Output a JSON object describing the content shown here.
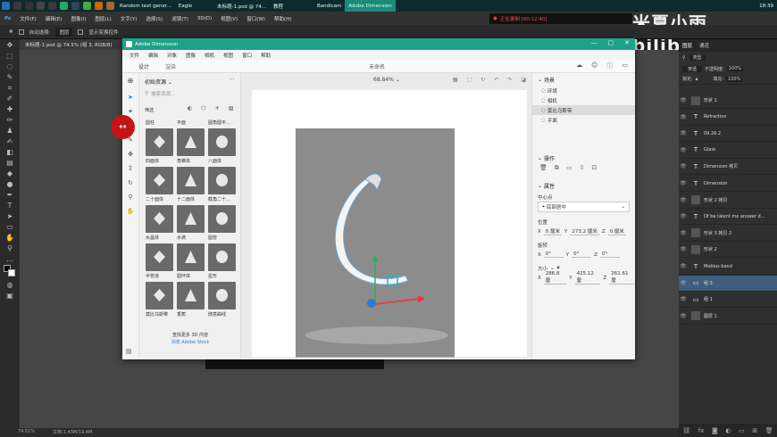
{
  "taskbar": {
    "tabs": [
      {
        "label": "Random text gener..."
      },
      {
        "label": "Eagle"
      },
      {
        "label": "未标题-1.psd @ 74..."
      },
      {
        "label": "教程"
      },
      {
        "label": "Bandicam"
      },
      {
        "label": "Adobe Dimension"
      }
    ],
    "clock": "18:39"
  },
  "recording": {
    "text": "正在录制 [00:12:40]"
  },
  "ps": {
    "menu": [
      "文件(F)",
      "编辑(E)",
      "图像(I)",
      "图层(L)",
      "文字(Y)",
      "选择(S)",
      "滤镜(T)",
      "3D(D)",
      "视图(V)",
      "窗口(W)",
      "帮助(H)"
    ],
    "options": {
      "auto_select": "自动选择:",
      "group": "图层",
      "transform": "显示变换控件"
    },
    "doc_tab": "未标题-1.psd @ 74.5% (组 3, RGB/8)",
    "status": {
      "zoom": "74.51%",
      "doc": "文档:1.43M/19.4M"
    }
  },
  "watermark": {
    "text": "米夏小雨 bilibili"
  },
  "layers_panel": {
    "tabs": [
      "图层",
      "通道"
    ],
    "kind_label": "类型",
    "blend": "穿透",
    "opacity_label": "不透明度:",
    "opacity": "100%",
    "lock_label": "锁定:",
    "fill_label": "填充:",
    "fill": "100%",
    "layers": [
      {
        "name": "形状 1",
        "type": "shape"
      },
      {
        "name": "Refraction",
        "type": "text"
      },
      {
        "name": "09.26.2",
        "type": "text"
      },
      {
        "name": "Glass",
        "type": "text"
      },
      {
        "name": "Dimension 拷贝",
        "type": "text"
      },
      {
        "name": "Dimension",
        "type": "text"
      },
      {
        "name": "形状 2 拷贝",
        "type": "shape"
      },
      {
        "name": "Of be talent me answer d...",
        "type": "text"
      },
      {
        "name": "形状 3 拷贝 2",
        "type": "shape"
      },
      {
        "name": "形状 2",
        "type": "shape"
      },
      {
        "name": "Mobius band",
        "type": "text"
      },
      {
        "name": "组 3",
        "type": "group",
        "selected": true
      },
      {
        "name": "组 1",
        "type": "group"
      },
      {
        "name": "图层 1",
        "type": "shape"
      }
    ]
  },
  "dimension": {
    "window_title": "Adobe Dimension",
    "menu": [
      "文件",
      "编辑",
      "对象",
      "图像",
      "相机",
      "视图",
      "窗口",
      "帮助"
    ],
    "modes": [
      "设计",
      "渲染"
    ],
    "doc_name": "未命名",
    "zoom": "68.84%",
    "library": {
      "title": "初始资源",
      "search_placeholder": "搜索资源...",
      "filter_label": "筛选",
      "row0": [
        "圆柱",
        "平面",
        "圆角圆平..."
      ],
      "items": [
        "四面体",
        "角锥体",
        "八面体",
        "二十面体",
        "十二面体",
        "截角二十...",
        "水晶体",
        "水滴",
        "圆管",
        "半管道",
        "圆环体",
        "星形",
        "莫比乌斯带",
        "香蕉",
        "随意曲线"
      ],
      "footer": "查找更多 3D 内容",
      "footer_link": "浏览 Adobe Stock"
    },
    "scene": {
      "title": "场景",
      "items": [
        "环境",
        "相机",
        "莫比乌斯带",
        "平面"
      ],
      "selected_index": 2
    },
    "actions": {
      "title": "操作"
    },
    "properties": {
      "title": "属性",
      "pivot_label": "中心点",
      "pivot_value": "底部居中",
      "position_label": "位置",
      "position": {
        "x": "0 厘米",
        "y": "273.2 厘米",
        "z": "0 厘米"
      },
      "rotation_label": "旋转",
      "rotation": {
        "x": "0°",
        "y": "0°",
        "z": "0°"
      },
      "size_label": "大小",
      "size": {
        "x": "286.8 厘",
        "y": "425.12 厘",
        "z": "261.61 厘"
      }
    }
  }
}
